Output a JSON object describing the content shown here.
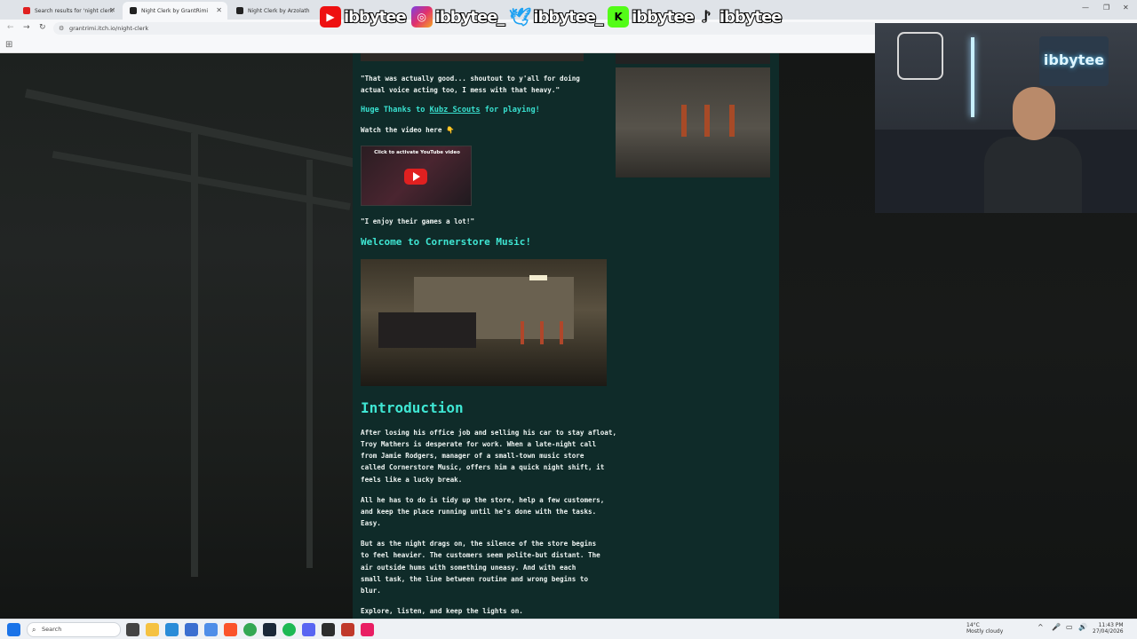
{
  "browser": {
    "tabs": [
      {
        "title": "Search results for 'night clerk'"
      },
      {
        "title": "Night Clerk by GrantRimi"
      },
      {
        "title": "Night Clerk by Arzolath"
      }
    ],
    "address": "grantrimi.itch.io/night-clerk",
    "favicons": {
      "red": "#e02020",
      "dark": "#222222"
    }
  },
  "overlay": {
    "handles": [
      {
        "platform": "youtube-icon",
        "handle": "ibbytee"
      },
      {
        "platform": "instagram-icon",
        "handle": "ibbytee_"
      },
      {
        "platform": "twitter-icon",
        "handle": "ibbytee_"
      },
      {
        "platform": "kick-icon",
        "handle": "ibbytee"
      },
      {
        "platform": "tiktok-icon",
        "handle": "ibbytee"
      }
    ],
    "webcam_sign": "ibbytee"
  },
  "content": {
    "quote1_a": "\"That was actually good... shoutout to y'all for doing",
    "quote1_b": "actual voice acting too, I mess with that heavy.\"",
    "thanks_prefix": "Huge Thanks to ",
    "thanks_link": "Kubz Scouts",
    "thanks_suffix": " for playing!",
    "watch": "Watch the video here 👇",
    "video_caption": "Click to activate YouTube video",
    "quote2": "\"I enjoy their games a lot!\"",
    "welcome_heading": "Welcome to Cornerstore Music!",
    "intro_heading": "Introduction",
    "p1": [
      "After losing his office job and selling his car to stay afloat,",
      "Troy Mathers is desperate for work. When a late-night call",
      "from Jamie Rodgers, manager of a small-town music store",
      "called Cornerstore Music, offers him a quick night shift, it",
      "feels like a lucky break."
    ],
    "p2": [
      "All he has to do is tidy up the store, help a few customers,",
      "and keep the place running until he's done with the tasks.",
      "Easy."
    ],
    "p3": [
      "But as the night drags on, the silence of the store begins",
      "to feel heavier. The customers seem polite-but distant. The",
      "air outside hums with something uneasy. And with each",
      "small task, the line between routine and wrong begins to",
      "blur."
    ],
    "p4": "Explore, listen, and keep the lights on."
  },
  "taskbar": {
    "search_placeholder": "Search",
    "weather_temp": "14°C",
    "weather_desc": "Mostly cloudy",
    "time": "11:43 PM",
    "date": "27/04/2026"
  },
  "colors": {
    "accent_teal": "#3fe6d3",
    "column_bg": "#0f2b29"
  }
}
